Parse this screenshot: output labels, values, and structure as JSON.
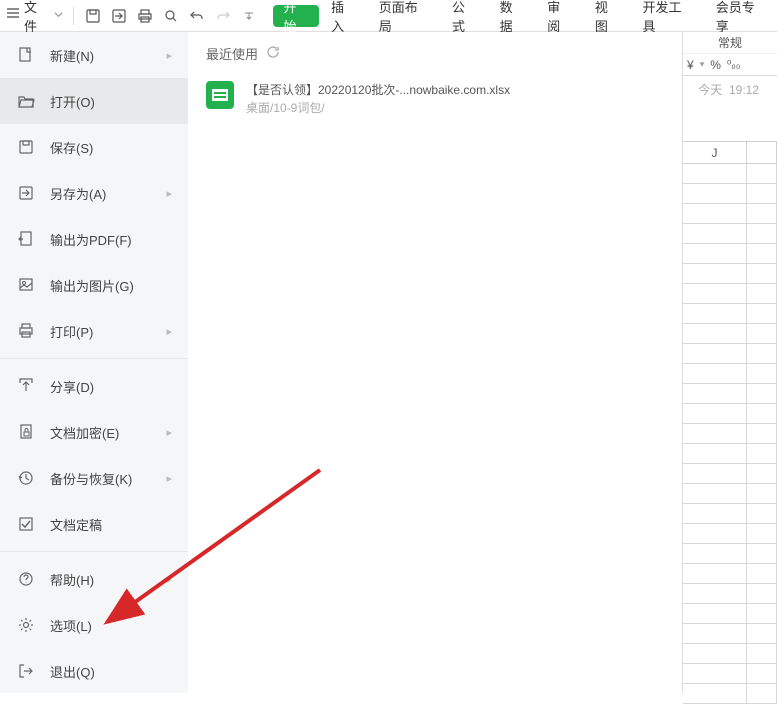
{
  "topbar": {
    "file_label": "文件",
    "tabs": [
      "开始",
      "插入",
      "页面布局",
      "公式",
      "数据",
      "审阅",
      "视图",
      "开发工具",
      "会员专享"
    ]
  },
  "menu": {
    "items": [
      {
        "label": "新建(N)",
        "arrow": true
      },
      {
        "label": "打开(O)",
        "arrow": false,
        "selected": true
      },
      {
        "label": "保存(S)",
        "arrow": false
      },
      {
        "label": "另存为(A)",
        "arrow": true
      },
      {
        "label": "输出为PDF(F)",
        "arrow": false
      },
      {
        "label": "输出为图片(G)",
        "arrow": false
      },
      {
        "label": "打印(P)",
        "arrow": true
      },
      {
        "sep": true
      },
      {
        "label": "分享(D)",
        "arrow": false
      },
      {
        "label": "文档加密(E)",
        "arrow": true
      },
      {
        "label": "备份与恢复(K)",
        "arrow": true
      },
      {
        "label": "文档定稿",
        "arrow": false
      },
      {
        "sep": true
      },
      {
        "label": "帮助(H)",
        "arrow": true
      },
      {
        "label": "选项(L)",
        "arrow": false
      },
      {
        "label": "退出(Q)",
        "arrow": false
      }
    ]
  },
  "recent": {
    "title": "最近使用",
    "file_name": "【是否认领】20220120批次-...nowbaike.com.xlsx",
    "file_path": "桌面/10-9词包/",
    "file_time_day": "今天",
    "file_time_clock": "19:12"
  },
  "sheet": {
    "format_label": "常规",
    "currency_icon": "¥",
    "percent_icon": "%",
    "decimal_icon": "⁰⁰₀",
    "col_j": "J"
  }
}
